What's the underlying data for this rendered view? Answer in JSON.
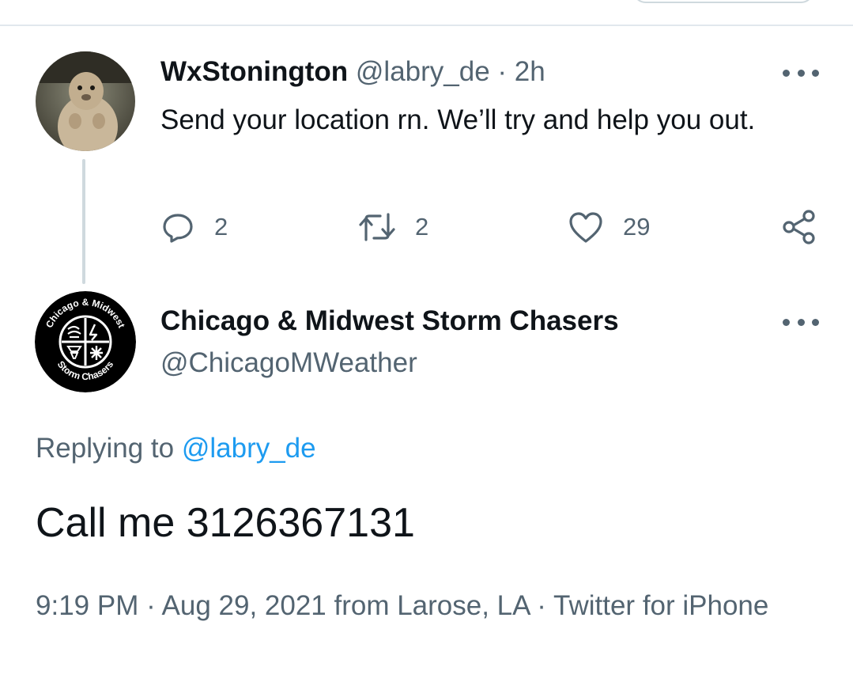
{
  "thread": {
    "tweet1": {
      "display_name": "WxStonington",
      "handle": "@labry_de",
      "separator": " · ",
      "time_ago": "2h",
      "text": "Send your location rn. We’ll try and help you out.",
      "avatar_icon": "marmot-avatar",
      "more_icon": "more-horizontal-icon",
      "actions": {
        "reply_icon": "reply-icon",
        "reply_count": "2",
        "retweet_icon": "retweet-icon",
        "retweet_count": "2",
        "like_icon": "heart-icon",
        "like_count": "29",
        "share_icon": "share-icon"
      }
    },
    "tweet2": {
      "display_name": "Chicago & Midwest Storm Chasers",
      "handle": "@ChicagoMWeather",
      "avatar_icon": "storm-chasers-logo",
      "avatar_ring_top": "Chicago & Midwest",
      "avatar_ring_bottom": "Storm Chasers",
      "more_icon": "more-horizontal-icon",
      "replying_prefix": "Replying to ",
      "replying_to": "@labry_de",
      "text": "Call me 3126367131",
      "timestamp": "9:19 PM · Aug 29, 2021 from Larose, LA · Twitter for iPhone"
    }
  },
  "colors": {
    "primary_text": "#0f1419",
    "secondary_text": "#536471",
    "link": "#1d9bf0",
    "divider": "#cfd9de"
  }
}
